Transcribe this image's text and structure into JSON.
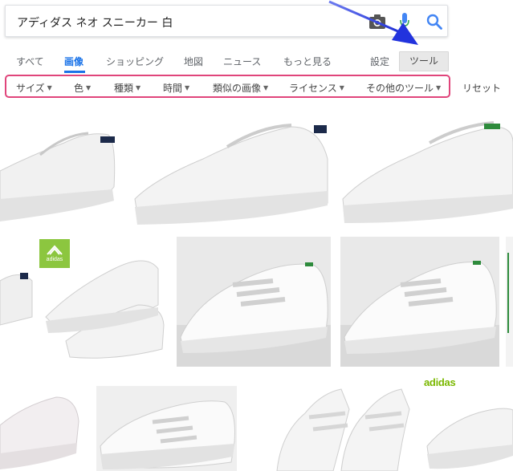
{
  "search": {
    "query": "アディダス ネオ スニーカー 白"
  },
  "tabs": [
    {
      "label": "すべて"
    },
    {
      "label": "画像"
    },
    {
      "label": "ショッピング"
    },
    {
      "label": "地図"
    },
    {
      "label": "ニュース"
    },
    {
      "label": "もっと見る"
    },
    {
      "label": "設定"
    }
  ],
  "tools_label": "ツール",
  "filters": [
    {
      "label": "サイズ"
    },
    {
      "label": "色"
    },
    {
      "label": "種類"
    },
    {
      "label": "時間"
    },
    {
      "label": "類似の画像"
    },
    {
      "label": "ライセンス"
    },
    {
      "label": "その他のツール"
    }
  ],
  "reset_label": "リセット",
  "logos": {
    "adidas_badge": "adidas",
    "adidas_word": "adidas"
  },
  "colors": {
    "accent": "#1a73e8",
    "highlight_border": "#e0457b",
    "annotation_arrow": "#2b3fe0",
    "adidas_green": "#8cc63f"
  },
  "icons": [
    "camera-icon",
    "mic-icon",
    "search-icon",
    "dropdown-arrow-icon"
  ]
}
